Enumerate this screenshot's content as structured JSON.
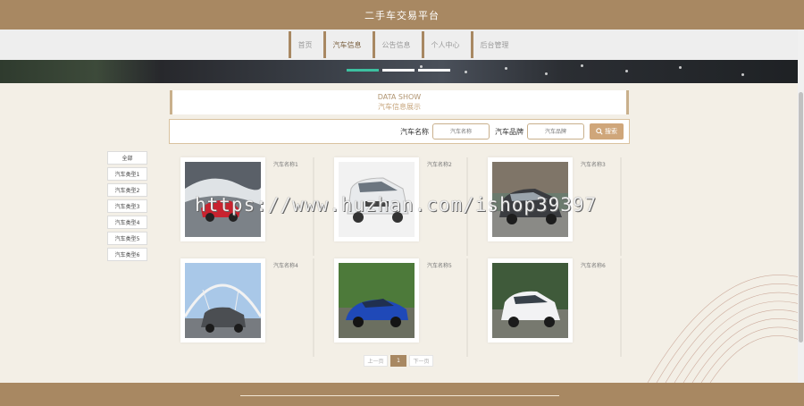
{
  "header": {
    "title": "二手车交易平台"
  },
  "nav": {
    "items": [
      {
        "label": "首页"
      },
      {
        "label": "汽车信息"
      },
      {
        "label": "公告信息"
      },
      {
        "label": "个人中心"
      },
      {
        "label": "后台管理"
      }
    ],
    "active_index": 1
  },
  "section": {
    "title_en": "DATA SHOW",
    "title_cn": "汽车信息展示"
  },
  "search": {
    "name_label": "汽车名称",
    "name_placeholder": "汽车名称",
    "brand_label": "汽车品牌",
    "brand_placeholder": "汽车品牌",
    "button_label": "搜索"
  },
  "categories": [
    "全部",
    "汽车类型1",
    "汽车类型2",
    "汽车类型3",
    "汽车类型4",
    "汽车类型5",
    "汽车类型6"
  ],
  "cars": [
    {
      "name": "汽车名称1"
    },
    {
      "name": "汽车名称2"
    },
    {
      "name": "汽车名称3"
    },
    {
      "name": "汽车名称4"
    },
    {
      "name": "汽车名称5"
    },
    {
      "name": "汽车名称6"
    }
  ],
  "pagination": {
    "prev": "上一页",
    "current": "1",
    "next": "下一页"
  },
  "watermark": "https://www.huzhan.com/ishop39397",
  "colors": {
    "brand": "#a88862",
    "accent": "#cfa67a",
    "active_dot": "#3dc0a0"
  }
}
